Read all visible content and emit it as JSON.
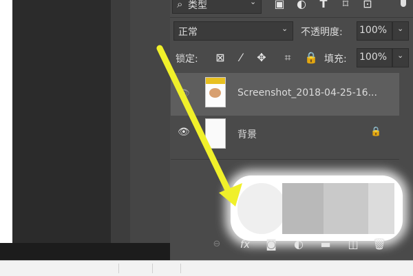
{
  "filter": {
    "kind_label": "类型",
    "search_glyph": "⌕"
  },
  "blend": {
    "mode_value": "正常",
    "opacity_label": "不透明度:",
    "opacity_value": "100%"
  },
  "lock": {
    "label": "锁定:",
    "fill_label": "填充:",
    "fill_value": "100%"
  },
  "layers": [
    {
      "name": "Screenshot_2018-04-25-16...",
      "visible": true,
      "selected": true
    },
    {
      "name": "背景",
      "visible": true,
      "locked": true
    }
  ],
  "icons": {
    "filter": [
      "image-filter-icon",
      "adjustment-filter-icon",
      "type-filter-icon",
      "shape-filter-icon",
      "smart-object-filter-icon"
    ],
    "lock": [
      "lock-transparent-pixels-icon",
      "lock-image-pixels-icon",
      "lock-position-icon",
      "lock-artboard-icon",
      "lock-all-icon"
    ],
    "footer": [
      "link-layers-icon",
      "layer-style-icon",
      "add-mask-icon",
      "adjustment-layer-icon",
      "new-group-icon",
      "new-layer-icon",
      "delete-layer-icon"
    ]
  },
  "colors": {
    "panel": "#4a4a4a",
    "selected_row": "#5e5e5e",
    "arrow": "#f0f02a",
    "thumb_yellow": "#e8c020"
  }
}
